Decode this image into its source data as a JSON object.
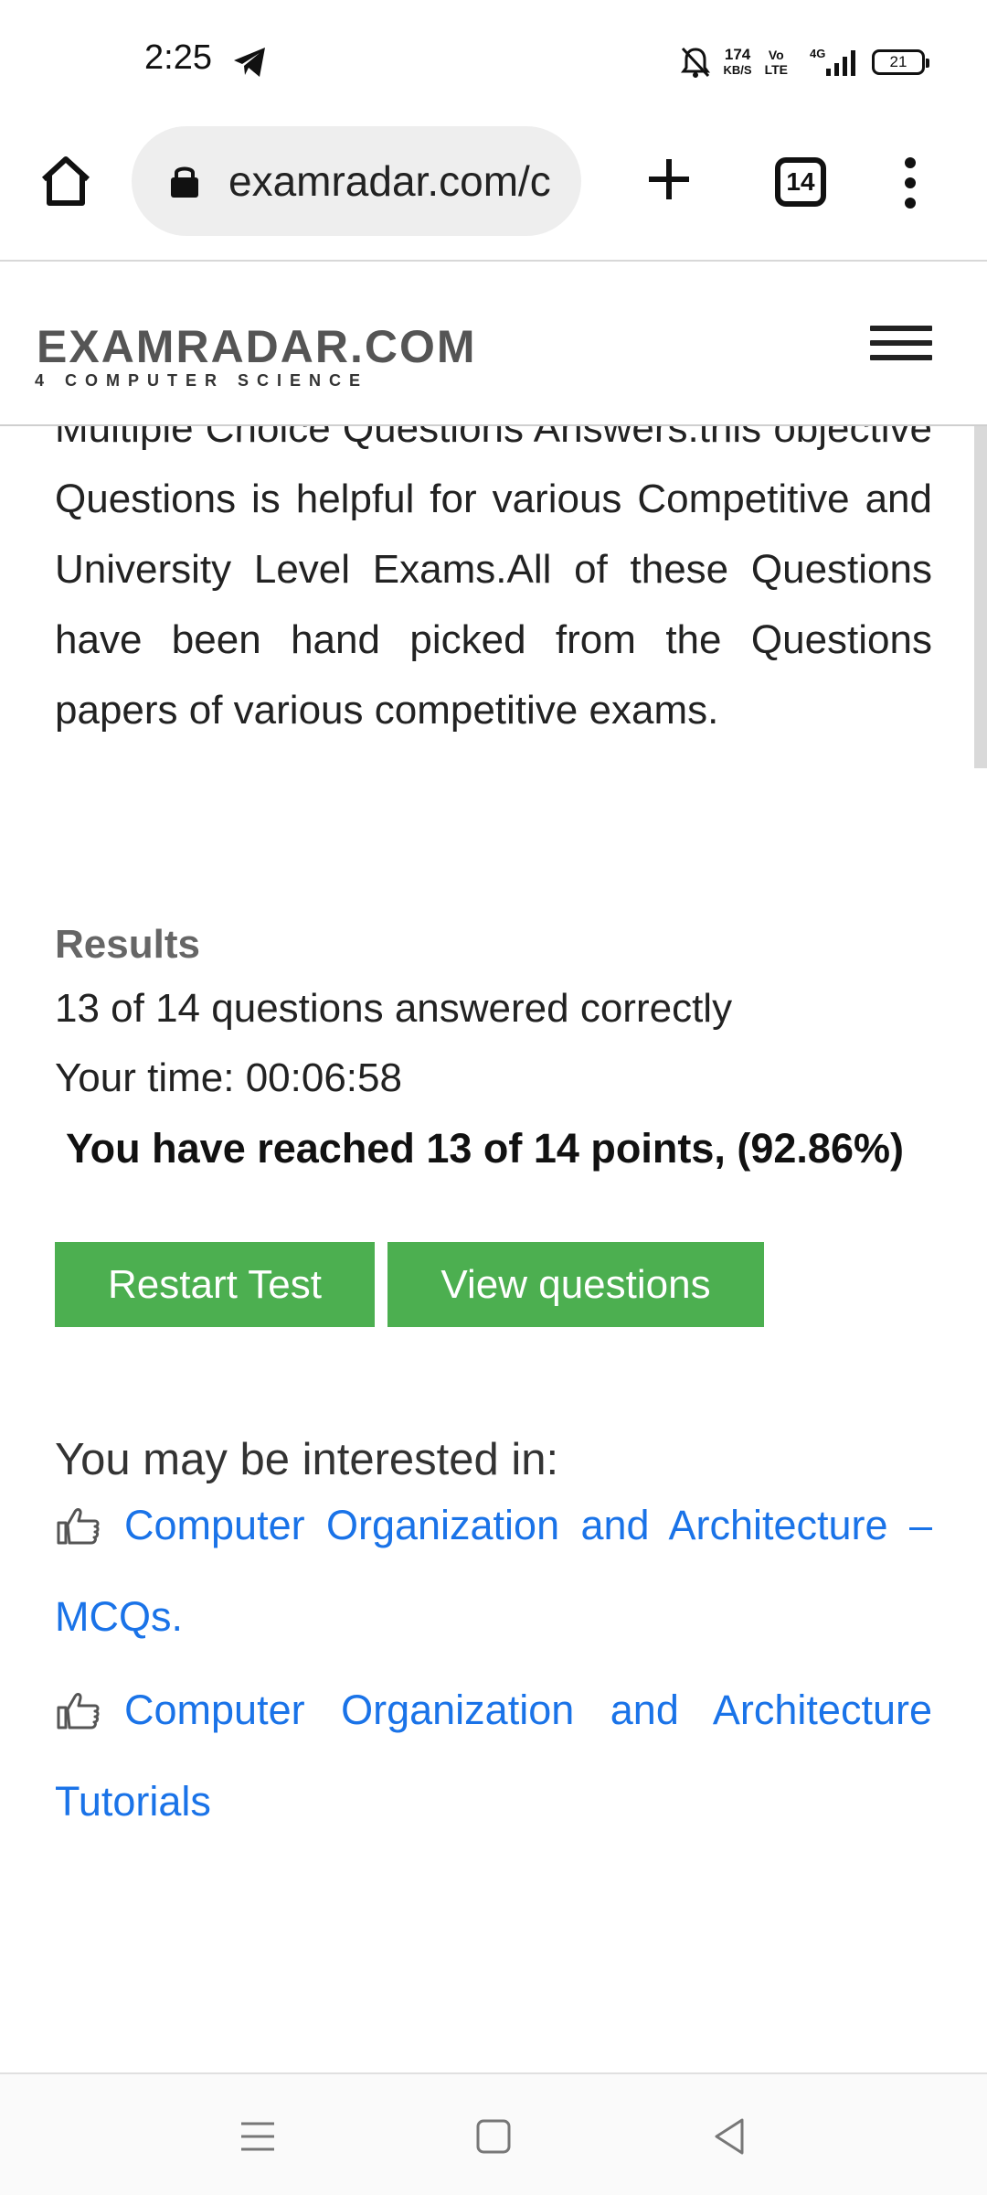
{
  "status_bar": {
    "time": "2:25",
    "net_speed_value": "174",
    "net_speed_unit": "KB/S",
    "volte_top": "Vo",
    "volte_bottom": "LTE",
    "network": "4G",
    "battery": "21"
  },
  "browser": {
    "url": "examradar.com/c",
    "tab_count": "14"
  },
  "site": {
    "logo_text": "EXAMRADAR.COM",
    "logo_tagline": "4 COMPUTER SCIENCE"
  },
  "content": {
    "intro_text": "Multiple Choice Questions Answers.this objective Questions is helpful for various Competitive and University Level Exams.All of these Questions have been hand picked from the Questions papers of various competitive exams.",
    "results": {
      "title": "Results",
      "answered": "13 of 14 questions answered correctly",
      "time": "Your time: 00:06:58",
      "points": "You have reached 13 of 14 points, (92.86%)"
    },
    "buttons": {
      "restart": "Restart Test",
      "view": "View questions"
    },
    "interested_heading": "You may be interested in:",
    "related_links": [
      {
        "label": "Computer Organization and Architecture – MCQs."
      },
      {
        "label": "Computer Organization and Architecture Tutorials"
      }
    ]
  },
  "colors": {
    "button_green": "#4caf50",
    "link_blue": "#1a73e8"
  },
  "icons": [
    "telegram-icon",
    "mute-icon",
    "signal-icon",
    "home-icon",
    "lock-icon",
    "plus-icon",
    "tabs-icon",
    "more-vert-icon",
    "menu-icon",
    "thumbs-up-icon",
    "nav-menu-icon",
    "nav-home-icon",
    "nav-back-icon"
  ]
}
